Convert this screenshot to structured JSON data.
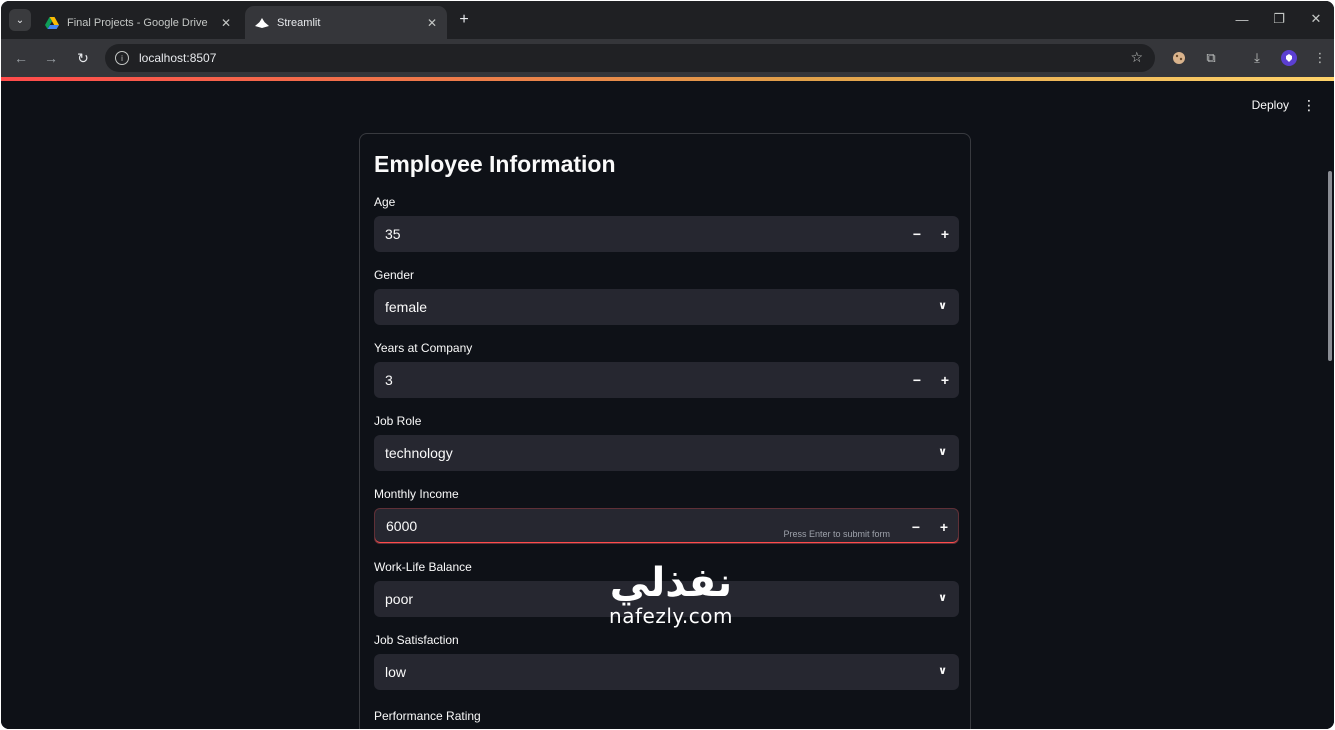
{
  "browser": {
    "tabs": [
      {
        "title": "Final Projects - Google Drive",
        "icon": "google-drive-icon"
      },
      {
        "title": "Streamlit",
        "icon": "streamlit-icon"
      }
    ],
    "url": "localhost:8507"
  },
  "app": {
    "deploy_label": "Deploy",
    "form": {
      "title": "Employee Information",
      "fields": [
        {
          "label": "Age",
          "value": "35",
          "type": "number"
        },
        {
          "label": "Gender",
          "value": "female",
          "type": "select"
        },
        {
          "label": "Years at Company",
          "value": "3",
          "type": "number"
        },
        {
          "label": "Job Role",
          "value": "technology",
          "type": "select"
        },
        {
          "label": "Monthly Income",
          "value": "6000",
          "type": "number",
          "hint": "Press Enter to submit form"
        },
        {
          "label": "Work-Life Balance",
          "value": "poor",
          "type": "select"
        },
        {
          "label": "Job Satisfaction",
          "value": "low",
          "type": "select"
        }
      ],
      "next_field_label": "Performance Rating"
    }
  },
  "watermark": {
    "arabic": "نفذلي",
    "latin": "nafezly.com"
  },
  "colors": {
    "background": "#0e1117",
    "input": "#262730",
    "accent": "#ff4b4b"
  }
}
